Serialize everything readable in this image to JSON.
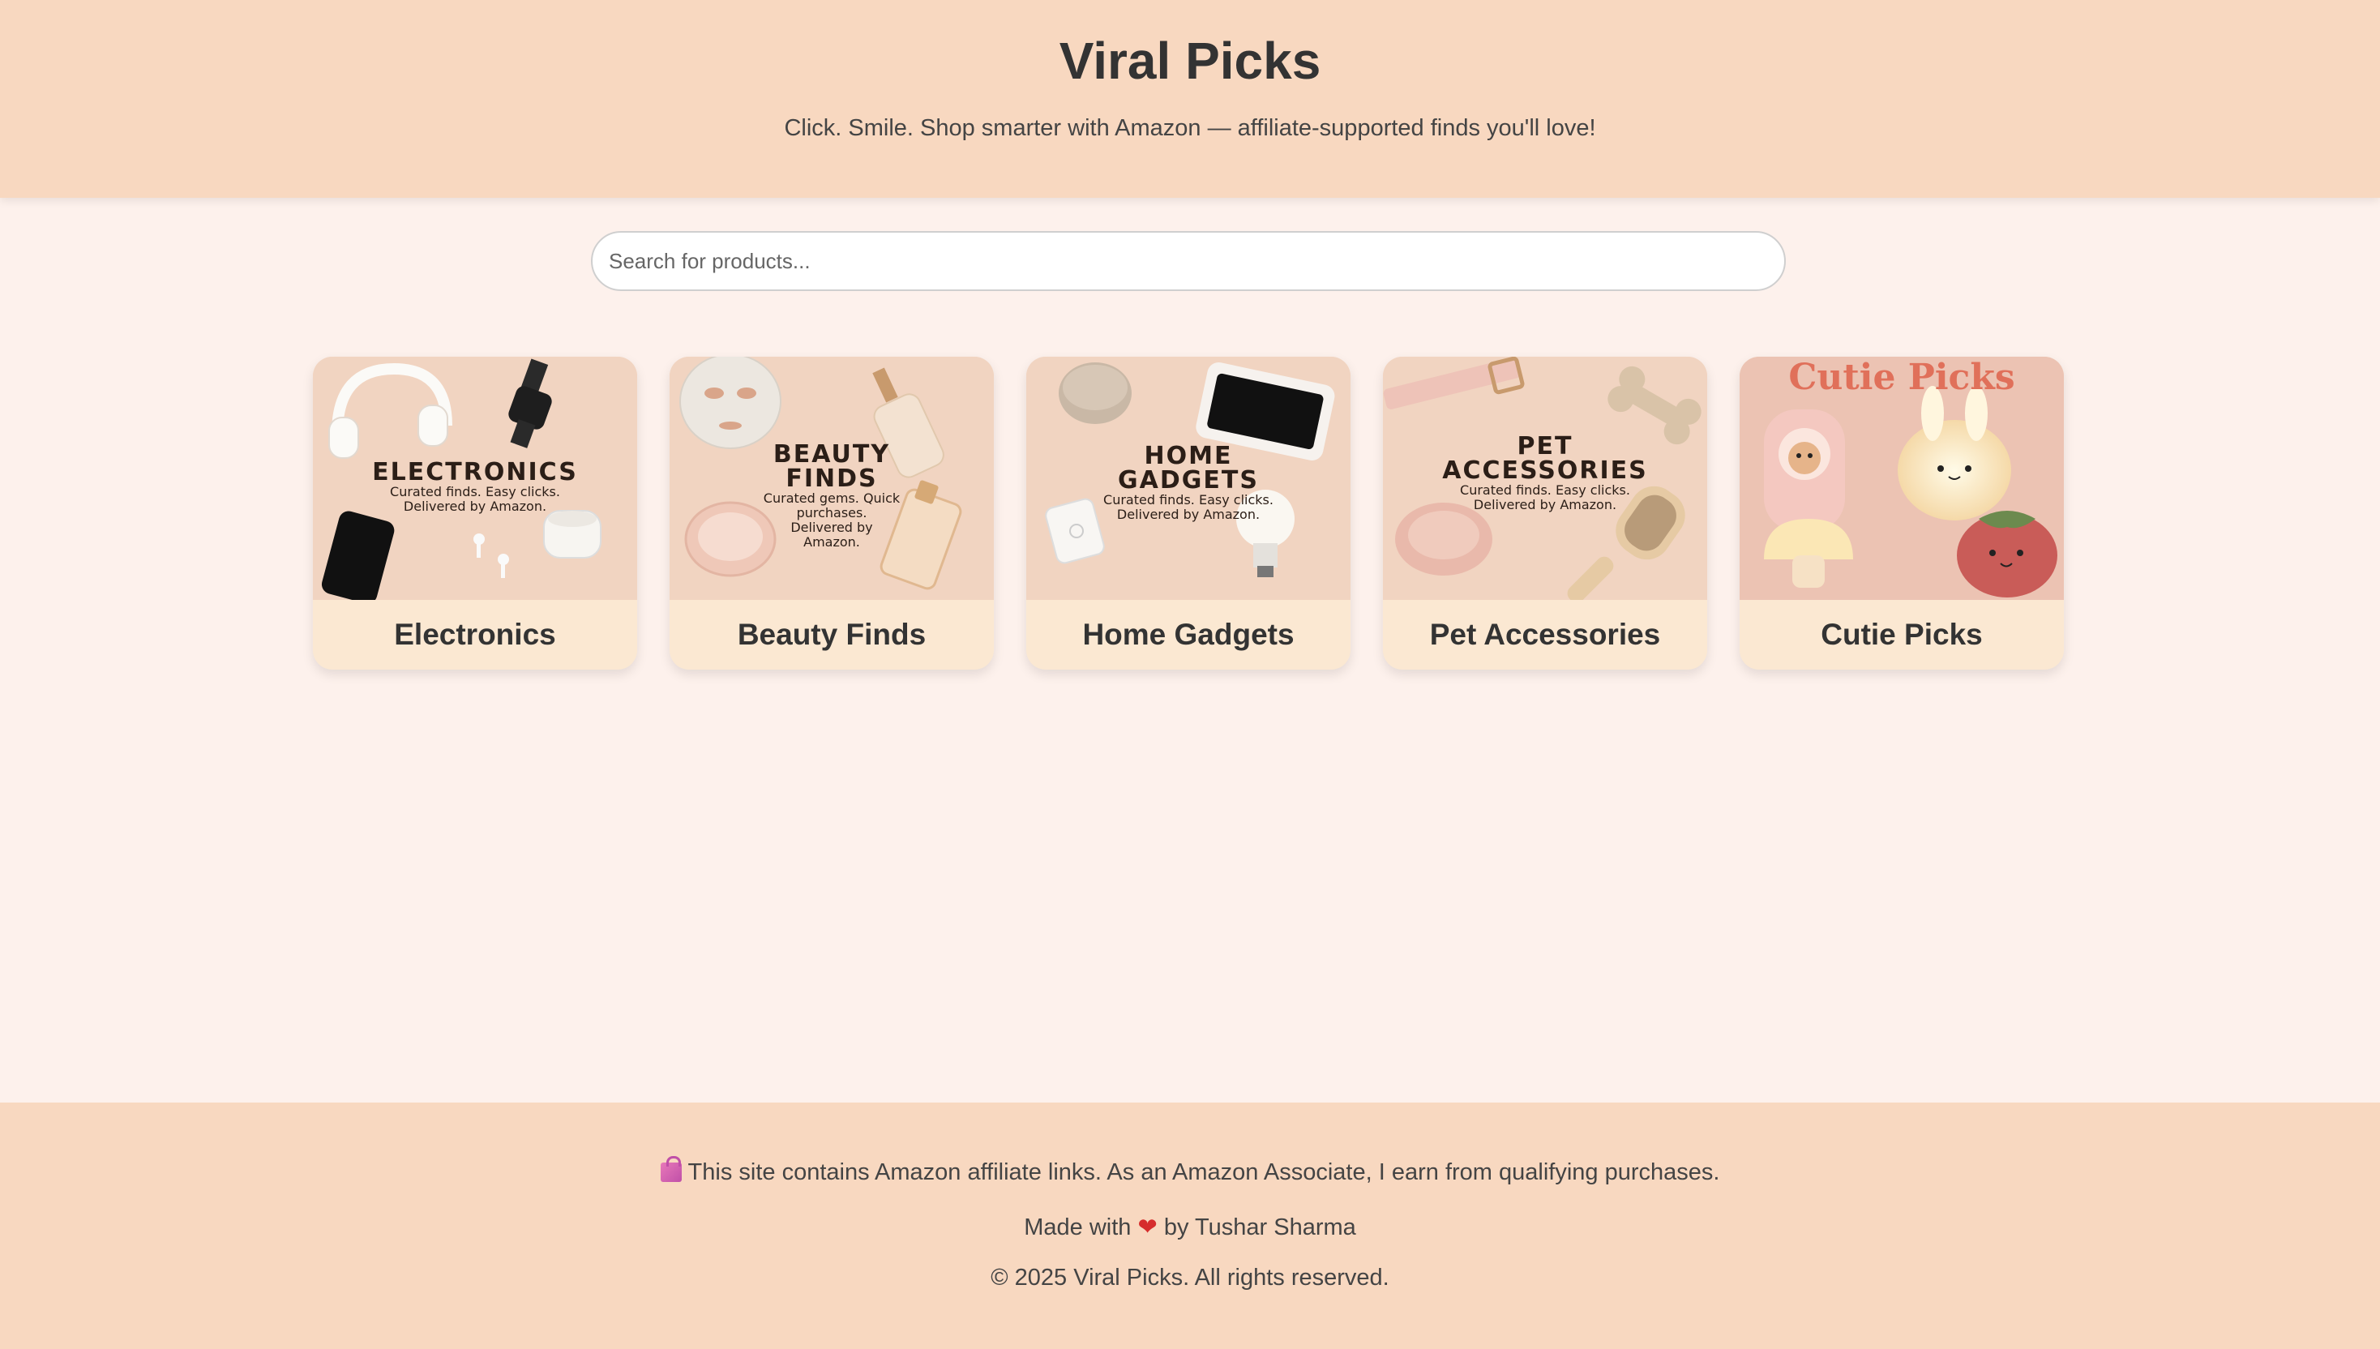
{
  "header": {
    "title": "Viral Picks",
    "subtitle": "Click. Smile. Shop smarter with Amazon — affiliate-supported finds you'll love!"
  },
  "search": {
    "placeholder": "Search for products...",
    "value": ""
  },
  "categories": [
    {
      "title": "Electronics",
      "image_heading": "ELECTRONICS",
      "image_sub_1": "Curated finds. Easy clicks.",
      "image_sub_2": "Delivered by Amazon."
    },
    {
      "title": "Beauty Finds",
      "image_heading_1": "BEAUTY",
      "image_heading_2": "FINDS",
      "image_sub_1": "Curated gems. Quick",
      "image_sub_2": "purchases.",
      "image_sub_3": "Delivered by",
      "image_sub_4": "Amazon."
    },
    {
      "title": "Home Gadgets",
      "image_heading_1": "HOME",
      "image_heading_2": "GADGETS",
      "image_sub_1": "Curated finds. Easy clicks.",
      "image_sub_2": "Delivered by Amazon."
    },
    {
      "title": "Pet Accessories",
      "image_heading_1": "PET",
      "image_heading_2": "ACCESSORIES",
      "image_sub_1": "Curated finds. Easy clicks.",
      "image_sub_2": "Delivered by Amazon."
    },
    {
      "title": "Cutie Picks",
      "image_heading": "Cutie Picks"
    }
  ],
  "footer": {
    "affiliate_icon": "shopping-bag-icon",
    "affiliate": "This site contains Amazon affiliate links. As an Amazon Associate, I earn from qualifying purchases.",
    "made_prefix": "Made with",
    "heart_icon": "heart-icon",
    "made_suffix": "by Tushar Sharma",
    "copyright": "© 2025 Viral Picks. All rights reserved."
  },
  "colors": {
    "header_bg": "#f8d8c0",
    "page_bg": "#fdf1ec",
    "card_caption_bg": "#fbe8d2",
    "cutie_accent": "#e0705a"
  }
}
